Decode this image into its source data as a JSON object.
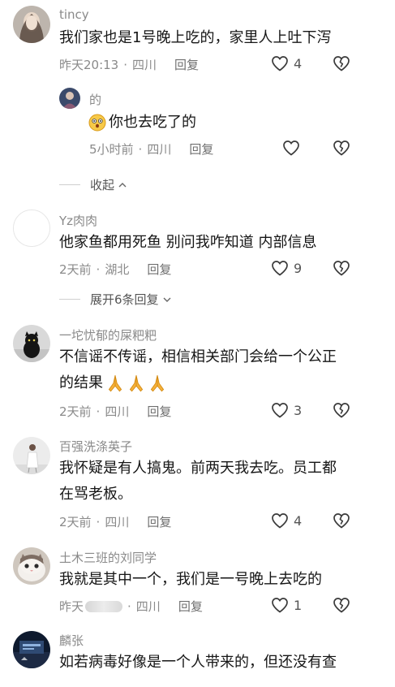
{
  "comments": [
    {
      "username": "tincy",
      "text": "我们家也是1号晚上吃的，家里人上吐下泻",
      "time": "昨天20:13",
      "location": "四川",
      "reply_label": "回复",
      "likes": "4",
      "replies": [
        {
          "username": "的",
          "text": "你也去吃了的",
          "time": "5小时前",
          "location": "四川",
          "reply_label": "回复",
          "likes": ""
        }
      ],
      "collapse_label": "收起"
    },
    {
      "username": "Yz肉肉",
      "text": "他家鱼都用死鱼 别问我咋知道 内部信息",
      "time": "2天前",
      "location": "湖北",
      "reply_label": "回复",
      "likes": "9",
      "expand_label": "展开6条回复"
    },
    {
      "username": "一坨忧郁的屎粑粑",
      "text": "不信谣不传谣，相信相关部门会给一个公正",
      "text2": "的结果",
      "time": "2天前",
      "location": "四川",
      "reply_label": "回复",
      "likes": "3"
    },
    {
      "username": "百强洗涤英子",
      "text": "我怀疑是有人搞鬼。前两天我去吃。员工都",
      "text2": "在骂老板。",
      "time": "2天前",
      "location": "四川",
      "reply_label": "回复",
      "likes": "4"
    },
    {
      "username": "土木三班的刘同学",
      "text": "我就是其中一个，我们是一号晚上去吃的",
      "time": "昨天",
      "location": "四川",
      "reply_label": "回复",
      "likes": "1"
    },
    {
      "username": "麟张",
      "text": "如若病毒好像是一个人带来的，但还没有查"
    }
  ],
  "icons": {
    "like": "heart-outline-icon",
    "dislike": "broken-heart-outline-icon",
    "emoji": "surprised-face-emoji-icon",
    "pray": "praying-hands-emoji-icon"
  },
  "colors": {
    "text": "#161616",
    "meta": "#8a8a8a",
    "icon": "#3a3a3a",
    "background": "#ffffff"
  }
}
